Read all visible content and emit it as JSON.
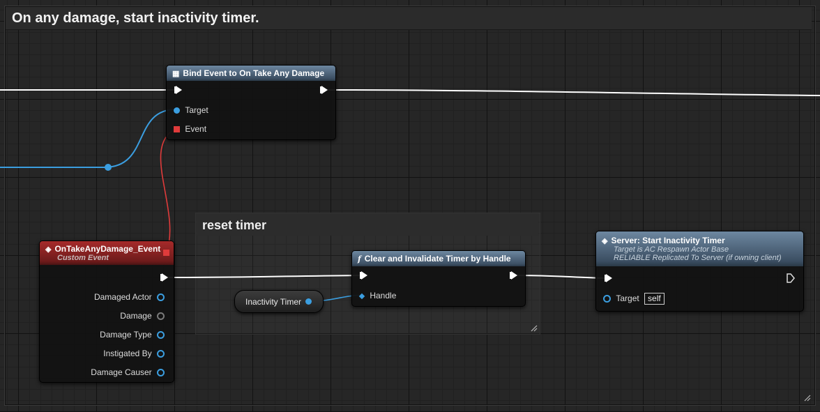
{
  "comment": {
    "title": "On any damage, start inactivity timer."
  },
  "group": {
    "title": "reset timer"
  },
  "bind_node": {
    "title": "Bind Event to On Take Any Damage",
    "pins": {
      "target": "Target",
      "event": "Event"
    }
  },
  "event_node": {
    "title": "OnTakeAnyDamage_Event",
    "subtitle": "Custom Event",
    "pins": [
      "Damaged Actor",
      "Damage",
      "Damage Type",
      "Instigated By",
      "Damage Causer"
    ]
  },
  "clear_node": {
    "title": "Clear and Invalidate Timer by Handle",
    "pins": {
      "handle": "Handle"
    }
  },
  "var_node": {
    "label": "Inactivity Timer"
  },
  "server_node": {
    "title": "Server: Start Inactivity Timer",
    "subtitle1": "Target is AC Respawn Actor Base",
    "subtitle2": "RELIABLE Replicated To Server (if owning client)",
    "target_label": "Target",
    "target_value": "self"
  },
  "colors": {
    "object_pin": "#3b9ee0",
    "delegate_pin": "#e03b3b",
    "float_pin": "#7a7a7a",
    "exec_wire": "#ffffff"
  }
}
